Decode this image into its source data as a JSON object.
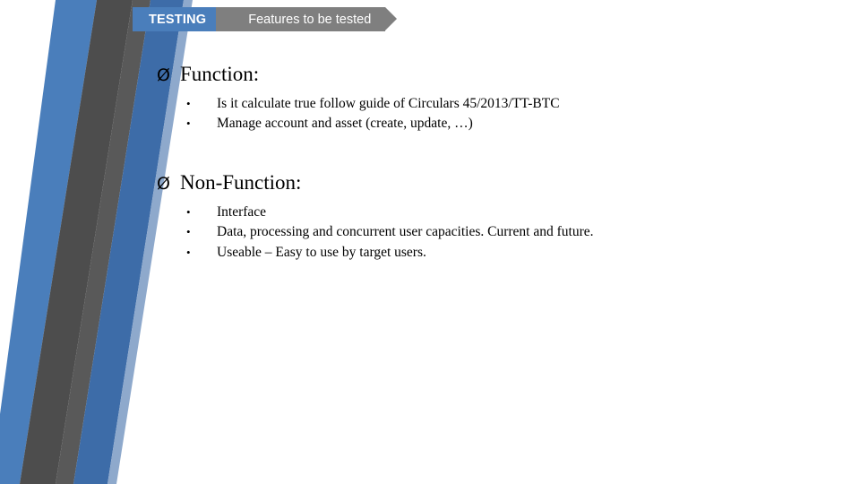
{
  "header": {
    "tag": "TESTING",
    "title": "Features to be tested",
    "tag_color": "#4a7ebb",
    "title_color": "#7f7f7f",
    "text_color": "#ffffff"
  },
  "graphic": {
    "name": "chevron-arrow-graphic",
    "blue": "#4a7ebb",
    "dark_gray": "#404040",
    "mid_gray": "#595959",
    "light_gray": "#a6a6a6"
  },
  "sections": [
    {
      "marker": "Ø",
      "heading": "Function:",
      "bullets": [
        "Is it calculate true follow guide of Circulars 45/2013/TT-BTC",
        "Manage account and asset (create, update, …)"
      ]
    },
    {
      "marker": "Ø",
      "heading": "Non-Function:",
      "bullets": [
        "Interface",
        "Data, processing and concurrent user capacities. Current and future.",
        "Useable – Easy to use by target users."
      ]
    }
  ],
  "bullet_glyph": "•"
}
